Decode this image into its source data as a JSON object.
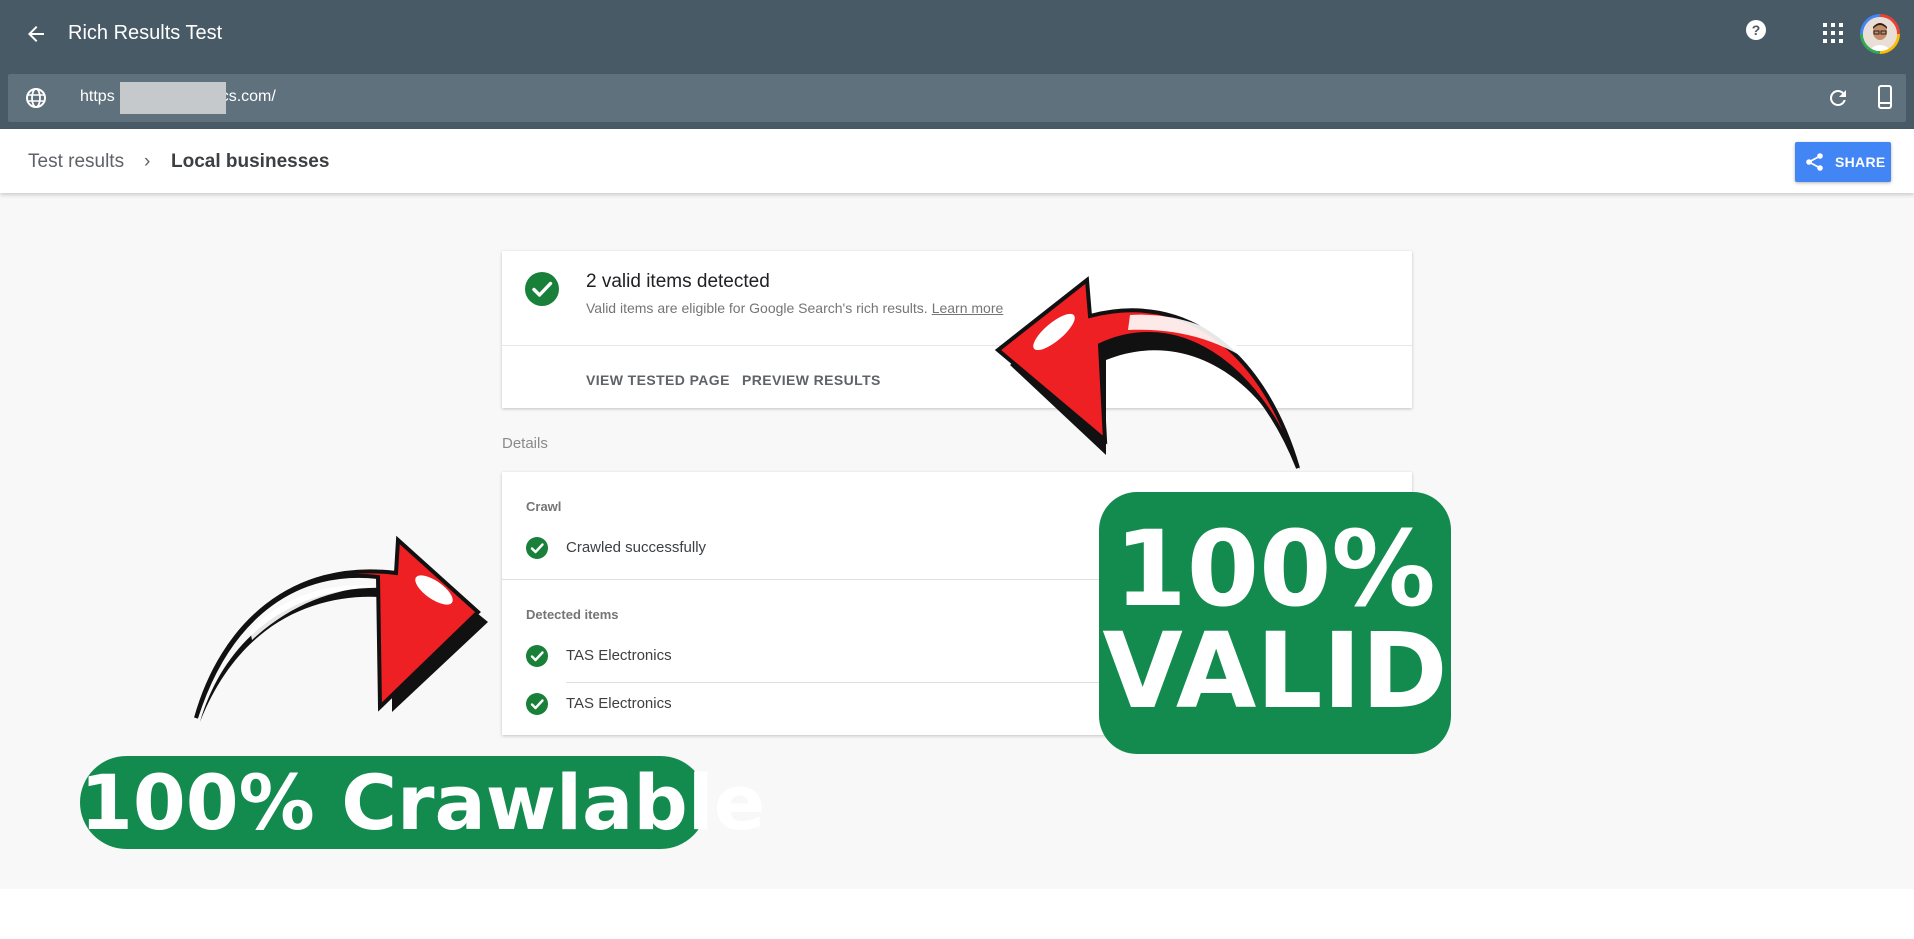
{
  "app": {
    "title": "Rich Results Test"
  },
  "url_bar": {
    "url_start": "https",
    "url_end": "cs.com/"
  },
  "breadcrumb": {
    "parent": "Test results",
    "separator": "›",
    "current": "Local businesses"
  },
  "share": {
    "label": "SHARE"
  },
  "summary": {
    "title": "2 valid items detected",
    "description": "Valid items are eligible for Google Search's rich results.",
    "learn_more": "Learn more",
    "actions": [
      "VIEW TESTED PAGE",
      "PREVIEW RESULTS"
    ]
  },
  "details": {
    "label": "Details",
    "crawl": {
      "label": "Crawl",
      "status": "Crawled successfully"
    },
    "detected": {
      "label": "Detected items",
      "items": [
        "TAS Electronics",
        "TAS Electronics"
      ]
    }
  },
  "overlays": {
    "valid_line1": "100%",
    "valid_line2": "VALID",
    "crawlable": "100% Crawlable"
  },
  "colors": {
    "topbar": "#475a66",
    "urlbar": "#5f717c",
    "share_button": "#4285f4",
    "success_green": "#188038",
    "badge_green": "#138b4f",
    "arrow_red": "#ee2024"
  },
  "icons": [
    "back-arrow-icon",
    "help-icon",
    "apps-grid-icon",
    "globe-icon",
    "reload-icon",
    "mobile-device-icon",
    "share-icon",
    "check-circle-icon"
  ]
}
